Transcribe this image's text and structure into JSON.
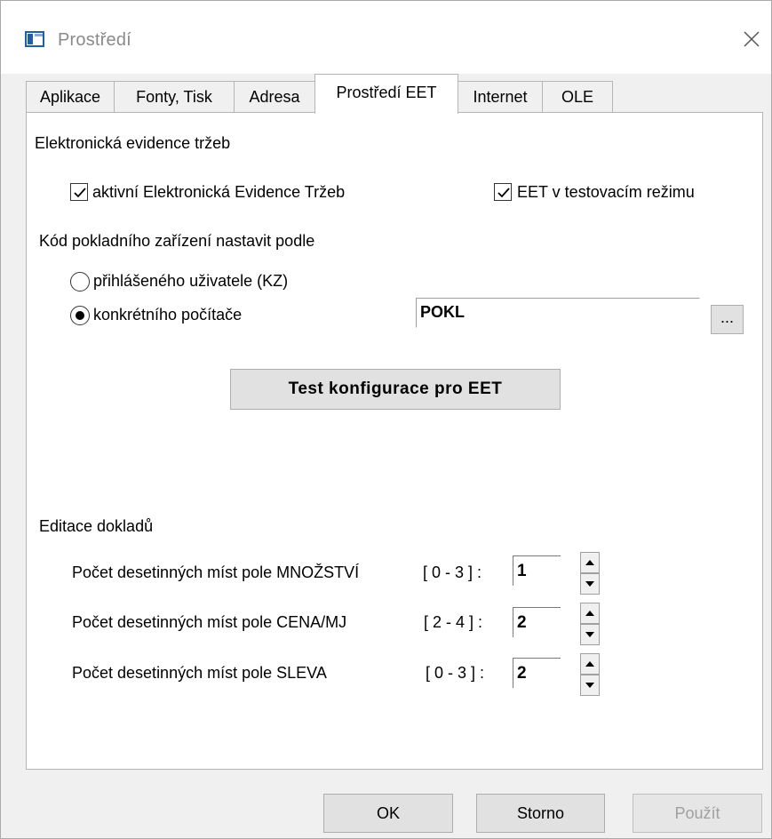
{
  "window": {
    "title": "Prostředí"
  },
  "tabs": [
    {
      "label": "Aplikace"
    },
    {
      "label": "Fonty, Tisk"
    },
    {
      "label": "Adresa"
    },
    {
      "label": "Prostředí EET",
      "active": true
    },
    {
      "label": "Internet"
    },
    {
      "label": "OLE"
    }
  ],
  "eet": {
    "section_title": "Elektronická evidence tržeb",
    "active_checkbox": {
      "label": "aktivní Elektronická Evidence Tržeb",
      "checked": true
    },
    "test_mode_checkbox": {
      "label": "EET v testovacím režimu",
      "checked": true
    },
    "device_code_title": "Kód pokladního zařízení nastavit podle",
    "radio_user": {
      "label": "přihlášeného uživatele (KZ)",
      "selected": false
    },
    "radio_computer": {
      "label": "konkrétního počítače",
      "selected": true
    },
    "computer_code_value": "POKL",
    "browse_button_label": "...",
    "test_button_label": "Test konfigurace pro EET"
  },
  "doc_edit": {
    "section_title": "Editace dokladů",
    "rows": [
      {
        "label": "Počet desetinných míst pole MNOŽSTVÍ",
        "range": "[ 0 - 3 ] :",
        "value": "1"
      },
      {
        "label": "Počet desetinných míst pole CENA/MJ",
        "range": "[ 2 - 4 ] :",
        "value": "2"
      },
      {
        "label": "Počet desetinných míst pole SLEVA",
        "range": "[ 0 - 3 ] :",
        "value": "2"
      }
    ]
  },
  "footer": {
    "ok_label": "OK",
    "cancel_label": "Storno",
    "apply_label": "Použít",
    "apply_enabled": false
  },
  "colors": {
    "title_text": "#8a8a8a",
    "icon_blue": "#1e5fa8",
    "button_face": "#e1e1e1",
    "disabled_text": "#a0a0a0"
  }
}
